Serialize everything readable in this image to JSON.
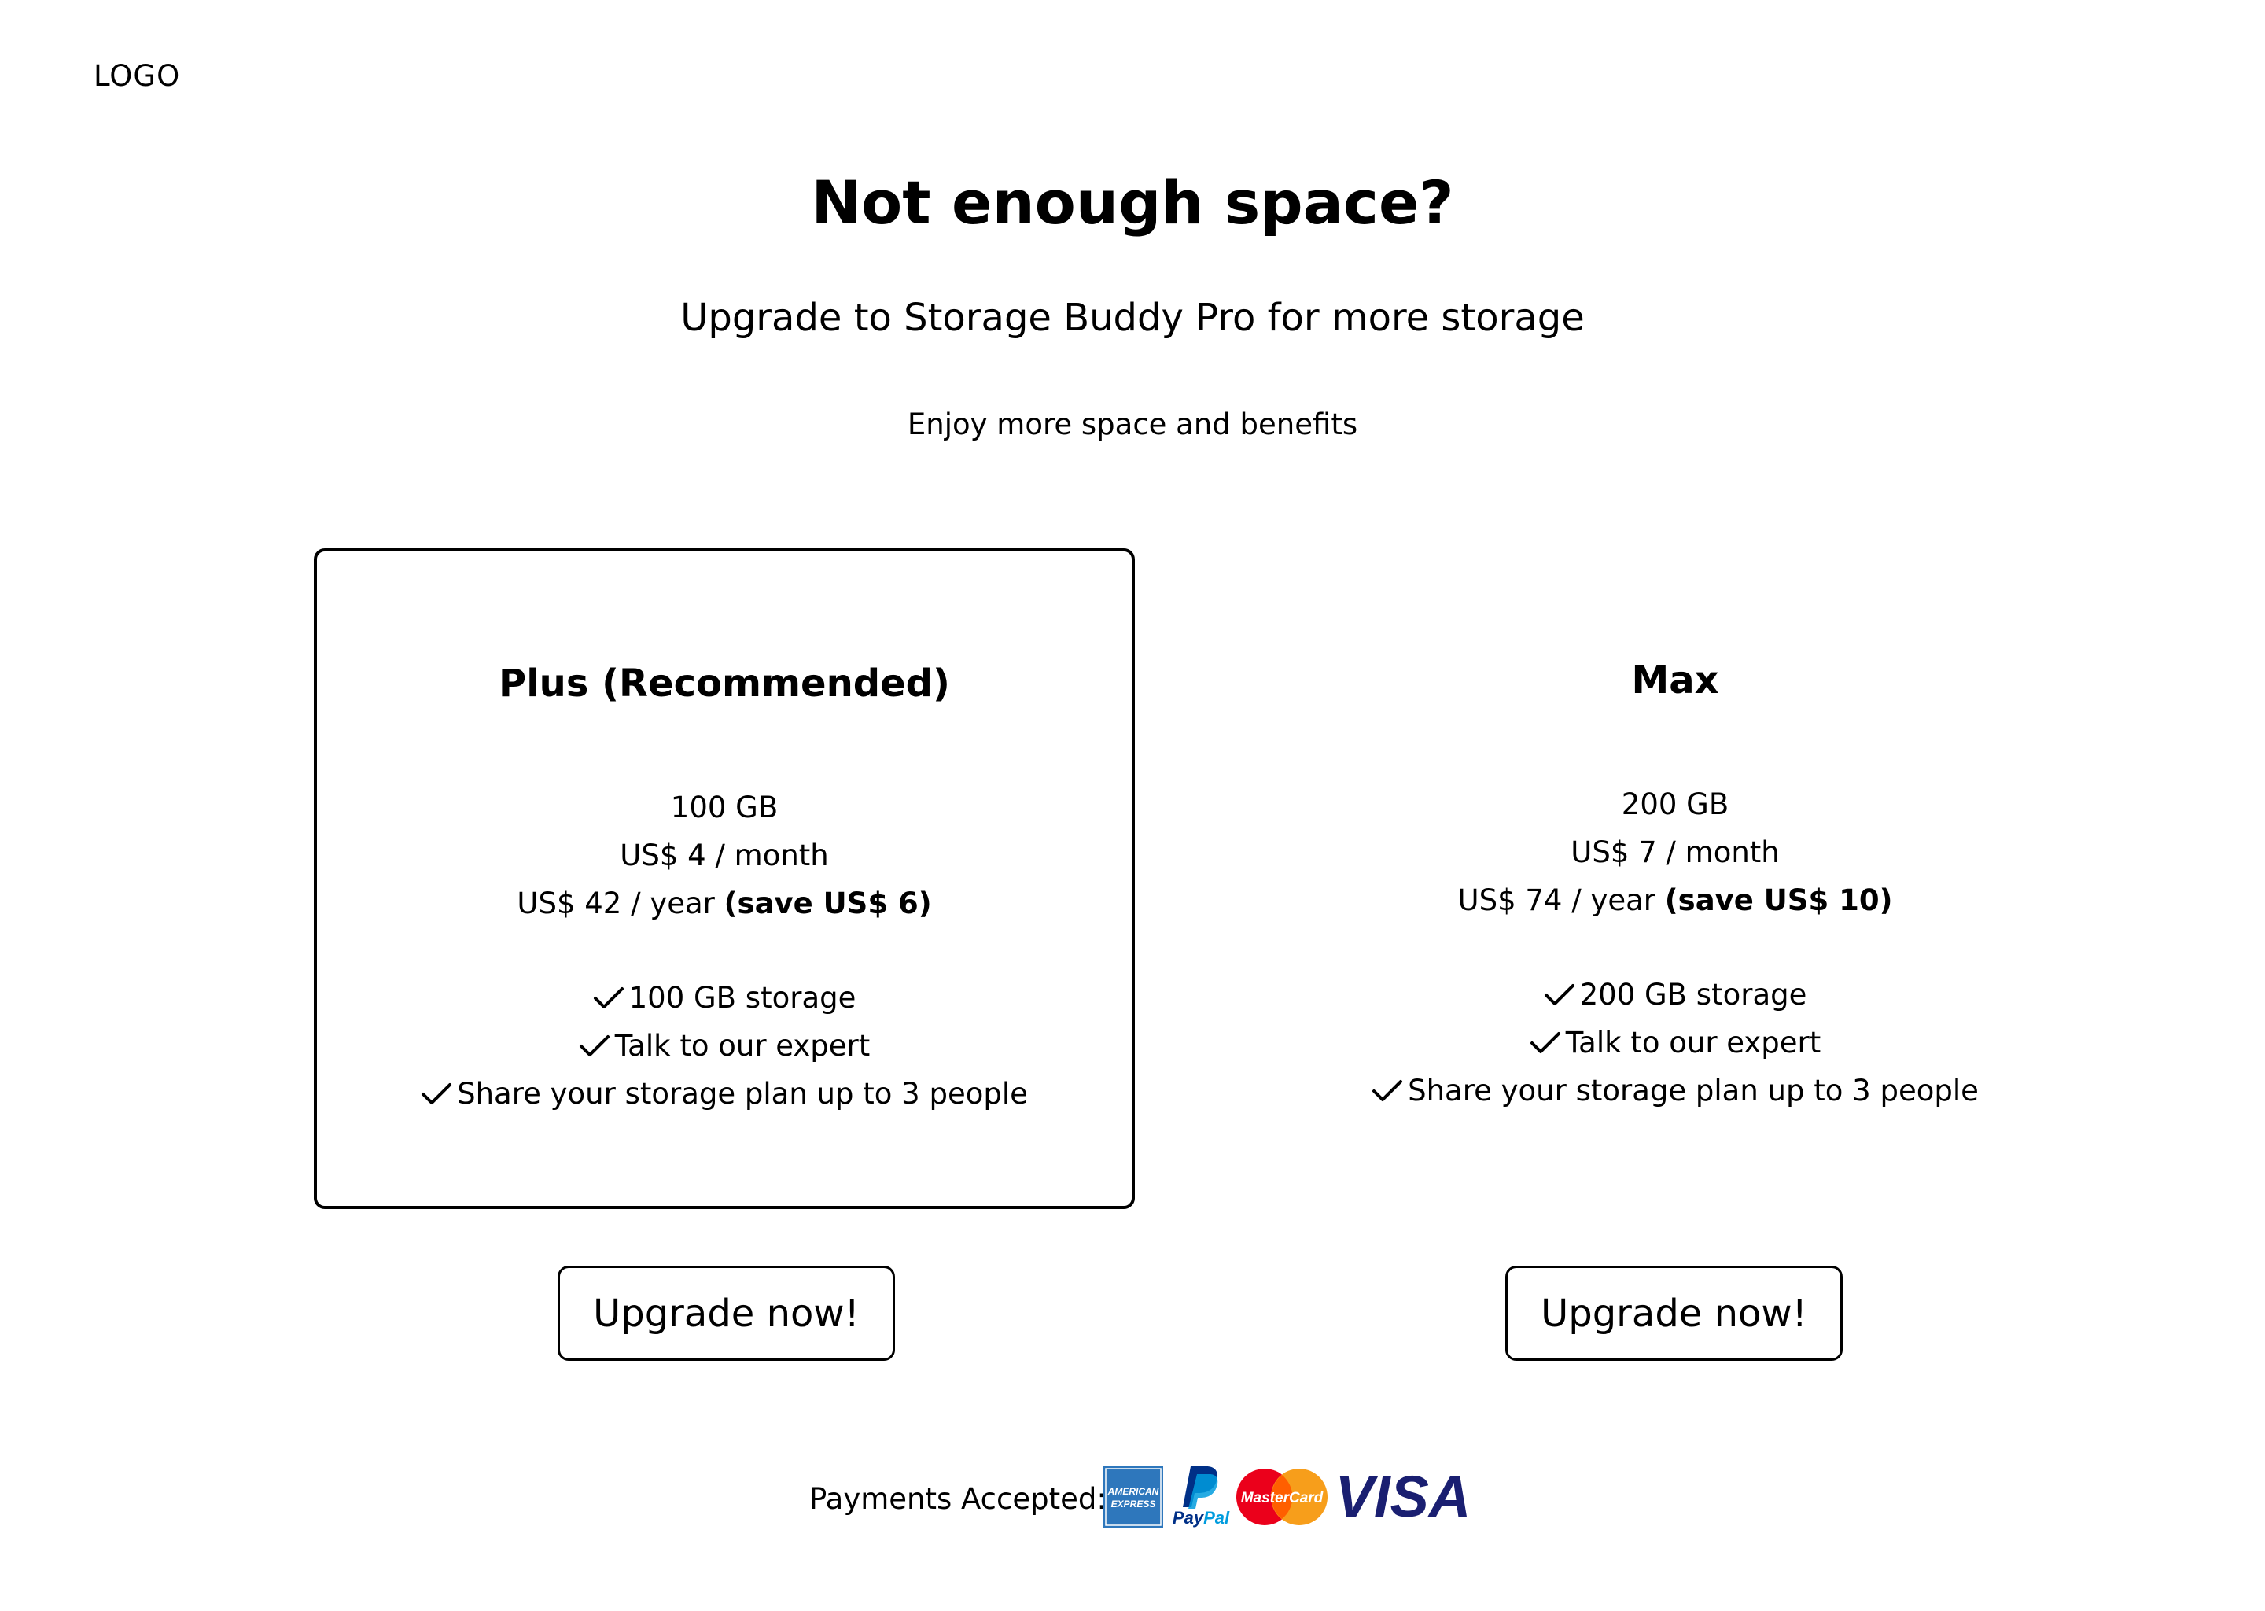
{
  "header": {
    "logo_text": "LOGO"
  },
  "hero": {
    "headline": "Not enough space?",
    "subhead": "Upgrade to Storage Buddy Pro for more storage",
    "tagline": "Enjoy more space and benefits"
  },
  "plans": [
    {
      "title": "Plus (Recommended)",
      "recommended": true,
      "storage": "100 GB",
      "monthly_price": "US$ 4 / month",
      "yearly_price": "US$ 42 / year",
      "yearly_savings": "(save US$ 6)",
      "features": [
        "100 GB storage",
        "Talk to our expert",
        "Share your storage plan up to 3 people"
      ],
      "button_label": "Upgrade now!"
    },
    {
      "title": "Max",
      "recommended": false,
      "storage": "200 GB",
      "monthly_price": "US$ 7 / month",
      "yearly_price": "US$ 74 / year",
      "yearly_savings": "(save US$ 10)",
      "features": [
        "200 GB storage",
        "Talk to our expert",
        "Share your storage plan up to 3 people"
      ],
      "button_label": "Upgrade now!"
    }
  ],
  "payments": {
    "label": "Payments Accepted:",
    "methods": [
      {
        "name": "American Express",
        "icon": "amex-icon",
        "logo_text": "AMERICAN EXPRESS",
        "color": "#2E77BC"
      },
      {
        "name": "PayPal",
        "icon": "paypal-icon",
        "logo_text": "PayPal",
        "color": "#003087"
      },
      {
        "name": "MasterCard",
        "icon": "mastercard-icon",
        "logo_text": "MasterCard",
        "color": "#EB001B"
      },
      {
        "name": "Visa",
        "icon": "visa-icon",
        "logo_text": "VISA",
        "color": "#1A1F71"
      }
    ]
  },
  "colors": {
    "text": "#000000",
    "background": "#FFFFFF",
    "border": "#000000"
  }
}
